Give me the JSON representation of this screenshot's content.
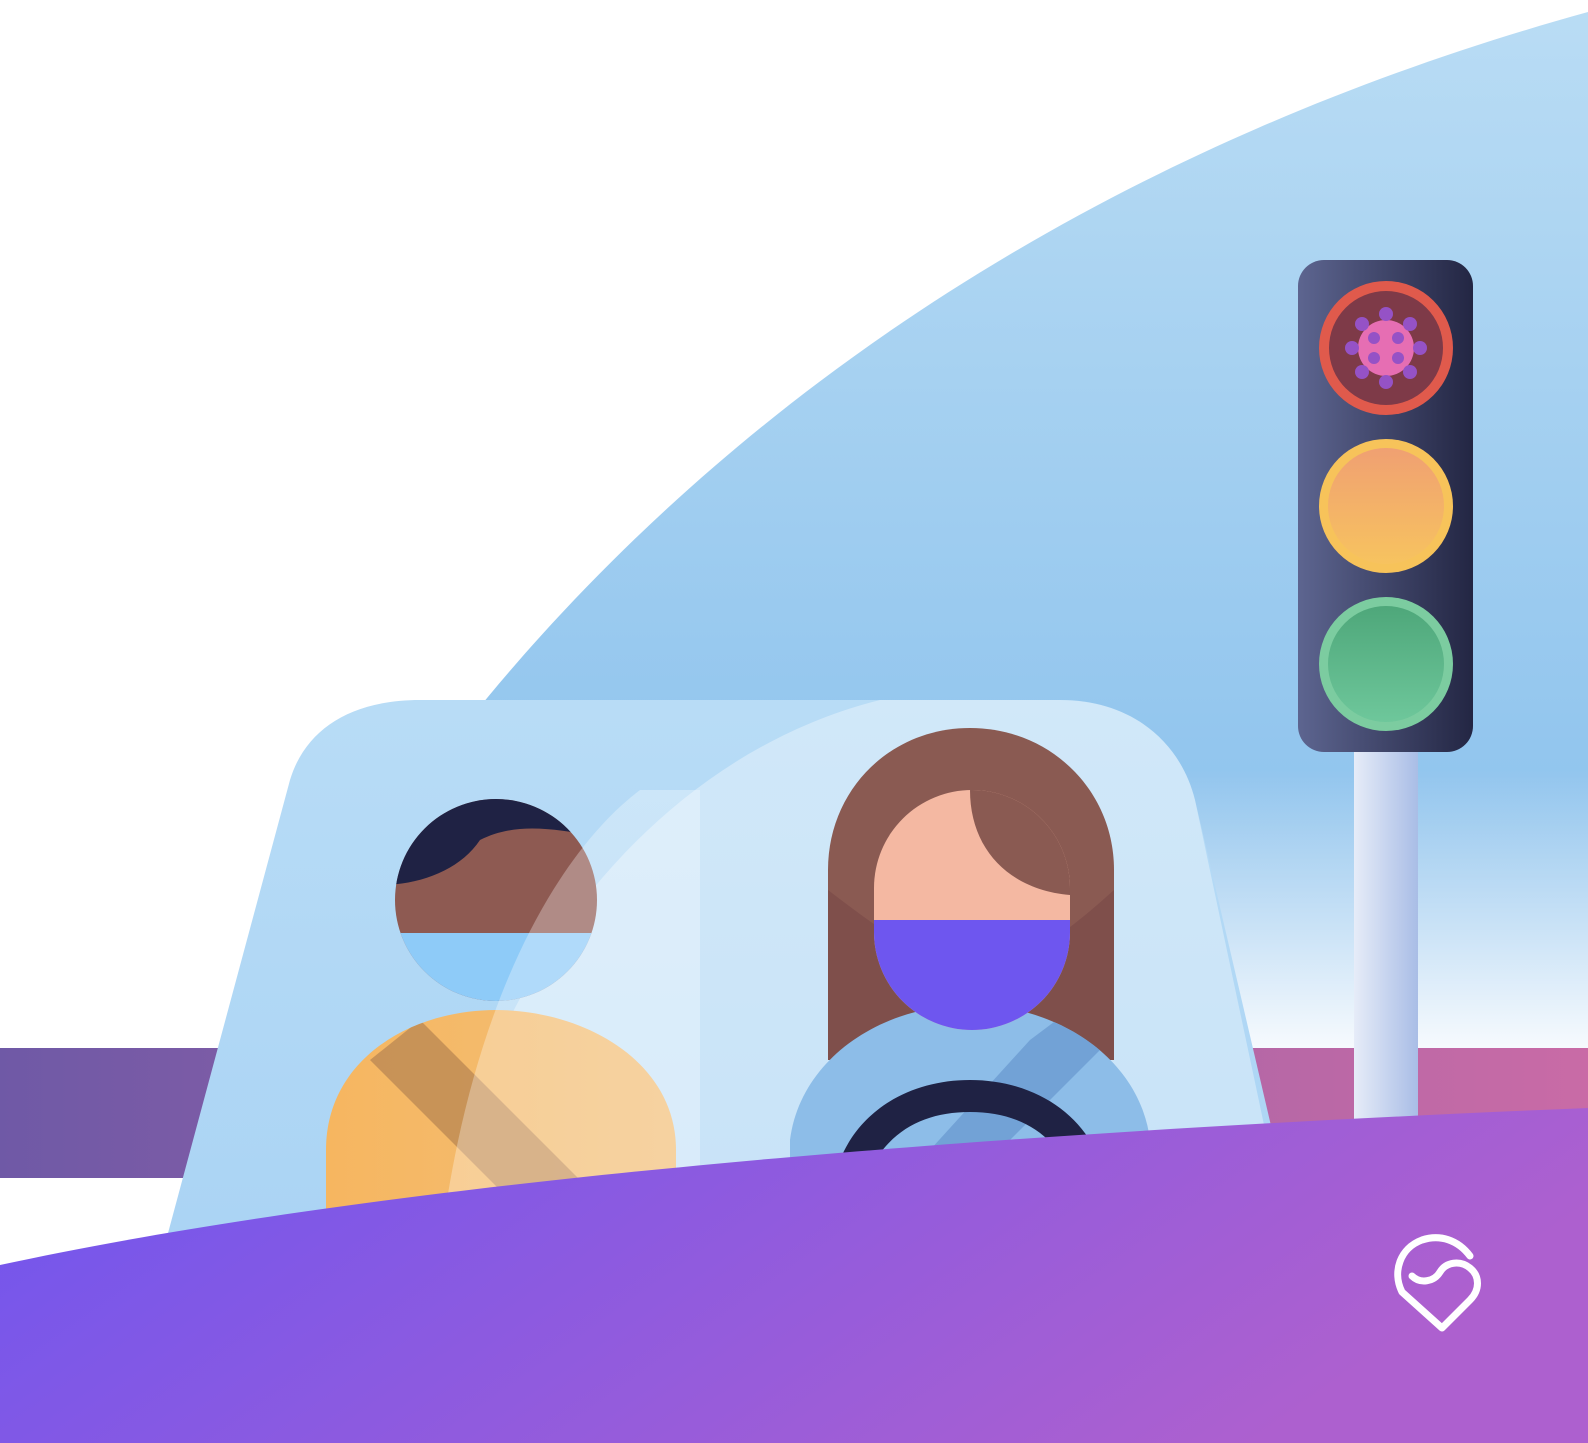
{
  "illustration": {
    "subject": "",
    "icons": {
      "virus": "virus-icon",
      "brand": "brand-logo-icon"
    },
    "colors": {
      "sky_top": "#b9dcf4",
      "sky_bottom": "#8fc2ec",
      "purple_band_left": "#6f59a6",
      "purple_band_right": "#c76ba6",
      "purple_foreground_left": "#6f55ef",
      "purple_foreground_right": "#a95fd1",
      "windshield": "#a9d4f4",
      "traffic_light_body": "#2a2d4a",
      "light_red": "#e05a4c",
      "light_yellow": "#f7b95c",
      "light_green": "#56b882",
      "mask_purple": "#6e56ef",
      "passenger_hair": "#1f2244",
      "passenger_skin": "#8e5a52",
      "driver_hair": "#8a5a52",
      "driver_skin": "#f4b8a2",
      "shirt_orange": "#f6b765",
      "shirt_blue": "#8dbde8",
      "virus_pink": "#e66eb3",
      "virus_purple": "#9552c6"
    }
  }
}
